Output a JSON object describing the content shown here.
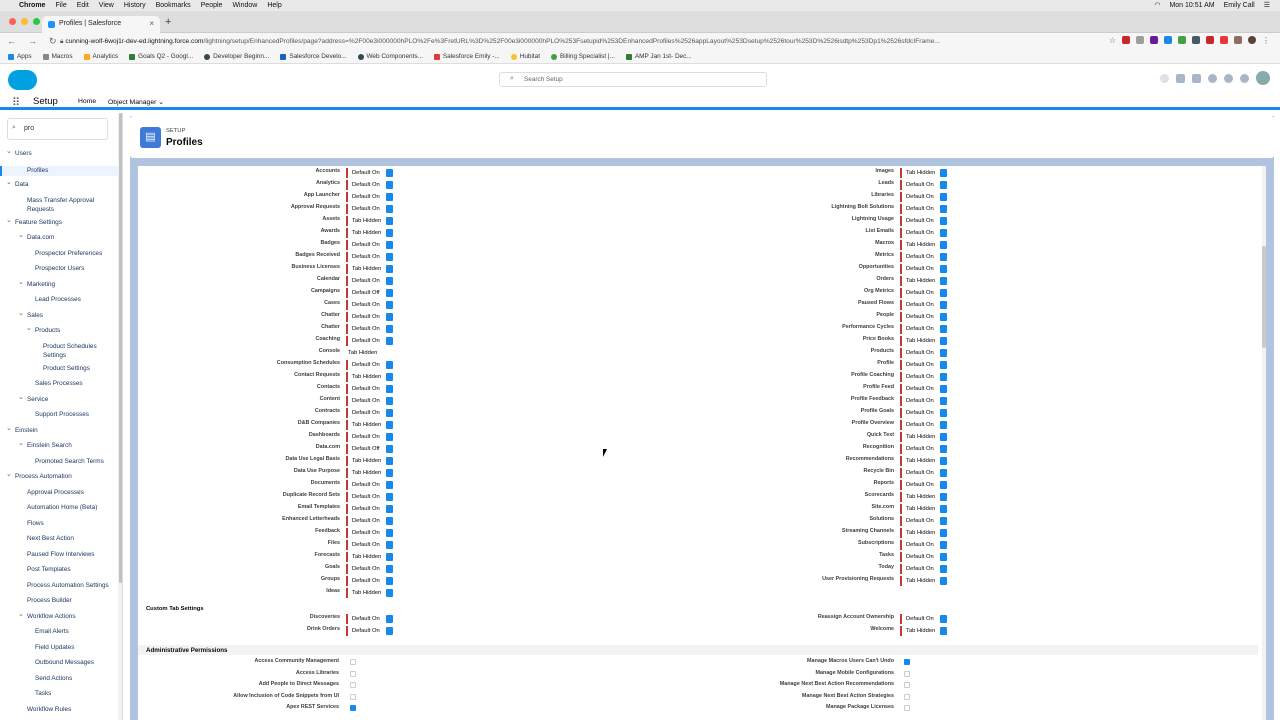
{
  "mac_menu": {
    "apple": "",
    "items": [
      "Chrome",
      "File",
      "Edit",
      "View",
      "History",
      "Bookmarks",
      "People",
      "Window",
      "Help"
    ],
    "time": "Mon 10:51 AM",
    "user": "Emily Call"
  },
  "browser": {
    "tab_title": "Profiles | Salesforce",
    "url_host": "cunning-wolf-6woj1r-dev-ed.lightning.force.com",
    "url_path": "/lightning/setup/EnhancedProfiles/page?address=%2F00e3i000000hPLO%2Fe%3FretURL%3D%252F00e3i000000hPLO%253Fsetupid%253DEnhancedProfiles%2526appLayout%253Dsetup%2526tour%253D%2526isdtp%253Dp1%2526sfdcIFrame...",
    "bookmarks": [
      "Apps",
      "Macros",
      "Analytics",
      "Goals Q2 - Googl...",
      "Developer Beginn...",
      "Salesforce Develo...",
      "Web Components...",
      "Salesforce Emily -...",
      "Hubitat",
      "Billing Specialist |...",
      "AMP Jan 1st- Dec..."
    ]
  },
  "header": {
    "search_placeholder": "Search Setup",
    "app_name": "Setup",
    "home_tab": "Home",
    "object_manager": "Object Manager"
  },
  "sidebar": {
    "quick_find": "pro",
    "items": [
      {
        "label": "Users",
        "level": 0,
        "caret": true
      },
      {
        "label": "Profiles",
        "level": 1,
        "selected": true
      },
      {
        "label": "Data",
        "level": 0,
        "caret": true
      },
      {
        "label": "Mass Transfer Approval",
        "level": 1
      },
      {
        "label": "Requests",
        "level": 1,
        "cont": true
      },
      {
        "label": "Feature Settings",
        "level": 0,
        "caret": true
      },
      {
        "label": "Data.com",
        "level": 1,
        "caret": true
      },
      {
        "label": "Prospector Preferences",
        "level": 2
      },
      {
        "label": "Prospector Users",
        "level": 2
      },
      {
        "label": "Marketing",
        "level": 1,
        "caret": true
      },
      {
        "label": "Lead Processes",
        "level": 2
      },
      {
        "label": "Sales",
        "level": 1,
        "caret": true
      },
      {
        "label": "Products",
        "level": 2,
        "caret": true
      },
      {
        "label": "Product Schedules",
        "level": 3
      },
      {
        "label": "Settings",
        "level": 3,
        "cont": true
      },
      {
        "label": "Product Settings",
        "level": 3
      },
      {
        "label": "Sales Processes",
        "level": 2
      },
      {
        "label": "Service",
        "level": 1,
        "caret": true
      },
      {
        "label": "Support Processes",
        "level": 2
      },
      {
        "label": "Einstein",
        "level": 0,
        "caret": true
      },
      {
        "label": "Einstein Search",
        "level": 1,
        "caret": true
      },
      {
        "label": "Promoted Search Terms",
        "level": 2
      },
      {
        "label": "Process Automation",
        "level": 0,
        "caret": true
      },
      {
        "label": "Approval Processes",
        "level": 1
      },
      {
        "label": "Automation Home (Beta)",
        "level": 1
      },
      {
        "label": "Flows",
        "level": 1
      },
      {
        "label": "Next Best Action",
        "level": 1
      },
      {
        "label": "Paused Flow Interviews",
        "level": 1
      },
      {
        "label": "Post Templates",
        "level": 1
      },
      {
        "label": "Process Automation Settings",
        "level": 1
      },
      {
        "label": "Process Builder",
        "level": 1
      },
      {
        "label": "Workflow Actions",
        "level": 1,
        "caret": true
      },
      {
        "label": "Email Alerts",
        "level": 2
      },
      {
        "label": "Field Updates",
        "level": 2
      },
      {
        "label": "Outbound Messages",
        "level": 2
      },
      {
        "label": "Send Actions",
        "level": 2
      },
      {
        "label": "Tasks",
        "level": 2
      },
      {
        "label": "Workflow Rules",
        "level": 1
      }
    ]
  },
  "page": {
    "object_type": "SETUP",
    "title": "Profiles"
  },
  "tab_settings_left": [
    [
      "Accounts",
      "Default On"
    ],
    [
      "Analytics",
      "Default On"
    ],
    [
      "App Launcher",
      "Default On"
    ],
    [
      "Approval Requests",
      "Default On"
    ],
    [
      "Assets",
      "Tab Hidden"
    ],
    [
      "Awards",
      "Tab Hidden"
    ],
    [
      "Badges",
      "Default On"
    ],
    [
      "Badges Received",
      "Default On"
    ],
    [
      "Business Licenses",
      "Tab Hidden"
    ],
    [
      "Calendar",
      "Default On"
    ],
    [
      "Campaigns",
      "Default Off"
    ],
    [
      "Cases",
      "Default On"
    ],
    [
      "Chatter",
      "Default On"
    ],
    [
      "Chatter",
      "Default On"
    ],
    [
      "Coaching",
      "Default On"
    ],
    [
      "Console",
      "Tab Hidden"
    ],
    [
      "Consumption Schedules",
      "Default On"
    ],
    [
      "Contact Requests",
      "Tab Hidden"
    ],
    [
      "Contacts",
      "Default On"
    ],
    [
      "Content",
      "Default On"
    ],
    [
      "Contracts",
      "Default On"
    ],
    [
      "D&B Companies",
      "Tab Hidden"
    ],
    [
      "Dashboards",
      "Default On"
    ],
    [
      "Data.com",
      "Default Off"
    ],
    [
      "Data Use Legal Basis",
      "Tab Hidden"
    ],
    [
      "Data Use Purpose",
      "Tab Hidden"
    ],
    [
      "Documents",
      "Default On"
    ],
    [
      "Duplicate Record Sets",
      "Default On"
    ],
    [
      "Email Templates",
      "Default On"
    ],
    [
      "Enhanced Letterheads",
      "Default On"
    ],
    [
      "Feedback",
      "Default On"
    ],
    [
      "Files",
      "Default On"
    ],
    [
      "Forecasts",
      "Tab Hidden"
    ],
    [
      "Goals",
      "Default On"
    ],
    [
      "Groups",
      "Default On"
    ],
    [
      "Ideas",
      "Tab Hidden"
    ]
  ],
  "tab_settings_right": [
    [
      "Images",
      "Tab Hidden"
    ],
    [
      "Leads",
      "Default On"
    ],
    [
      "Libraries",
      "Default On"
    ],
    [
      "Lightning Bolt Solutions",
      "Default On"
    ],
    [
      "Lightning Usage",
      "Default On"
    ],
    [
      "List Emails",
      "Default On"
    ],
    [
      "Macros",
      "Tab Hidden"
    ],
    [
      "Metrics",
      "Default On"
    ],
    [
      "Opportunities",
      "Default On"
    ],
    [
      "Orders",
      "Tab Hidden"
    ],
    [
      "Org Metrics",
      "Default On"
    ],
    [
      "Paused Flows",
      "Default On"
    ],
    [
      "People",
      "Default On"
    ],
    [
      "Performance Cycles",
      "Default On"
    ],
    [
      "Price Books",
      "Tab Hidden"
    ],
    [
      "Products",
      "Default On"
    ],
    [
      "Profile",
      "Default On"
    ],
    [
      "Profile Coaching",
      "Default On"
    ],
    [
      "Profile Feed",
      "Default On"
    ],
    [
      "Profile Feedback",
      "Default On"
    ],
    [
      "Profile Goals",
      "Default On"
    ],
    [
      "Profile Overview",
      "Default On"
    ],
    [
      "Quick Text",
      "Tab Hidden"
    ],
    [
      "Recognition",
      "Default On"
    ],
    [
      "Recommendations",
      "Tab Hidden"
    ],
    [
      "Recycle Bin",
      "Default On"
    ],
    [
      "Reports",
      "Default On"
    ],
    [
      "Scorecards",
      "Tab Hidden"
    ],
    [
      "Site.com",
      "Tab Hidden"
    ],
    [
      "Solutions",
      "Default On"
    ],
    [
      "Streaming Channels",
      "Tab Hidden"
    ],
    [
      "Subscriptions",
      "Default On"
    ],
    [
      "Tasks",
      "Default On"
    ],
    [
      "Today",
      "Default On"
    ],
    [
      "User Provisioning Requests",
      "Tab Hidden"
    ]
  ],
  "custom_tab_heading": "Custom Tab Settings",
  "custom_tabs_left": [
    [
      "Discoveries",
      "Default On"
    ],
    [
      "Drink Orders",
      "Default On"
    ]
  ],
  "custom_tabs_right": [
    [
      "Reassign Account Ownership",
      "Default On"
    ],
    [
      "Welcome",
      "Tab Hidden"
    ]
  ],
  "admin_heading": "Administrative Permissions",
  "admin_left": [
    [
      "Access Community Management",
      false
    ],
    [
      "Access Libraries",
      false
    ],
    [
      "Add People to Direct Messages",
      false
    ],
    [
      "Allow Inclusion of Code Snippets from UI",
      false
    ],
    [
      "Apex REST Services",
      true
    ]
  ],
  "admin_right": [
    [
      "Manage Macros Users Can't Undo",
      true
    ],
    [
      "Manage Mobile Configurations",
      false
    ],
    [
      "Manage Next Best Action Recommendations",
      false
    ],
    [
      "Manage Next Best Action Strategies",
      false
    ],
    [
      "Manage Package Licenses",
      false
    ]
  ]
}
